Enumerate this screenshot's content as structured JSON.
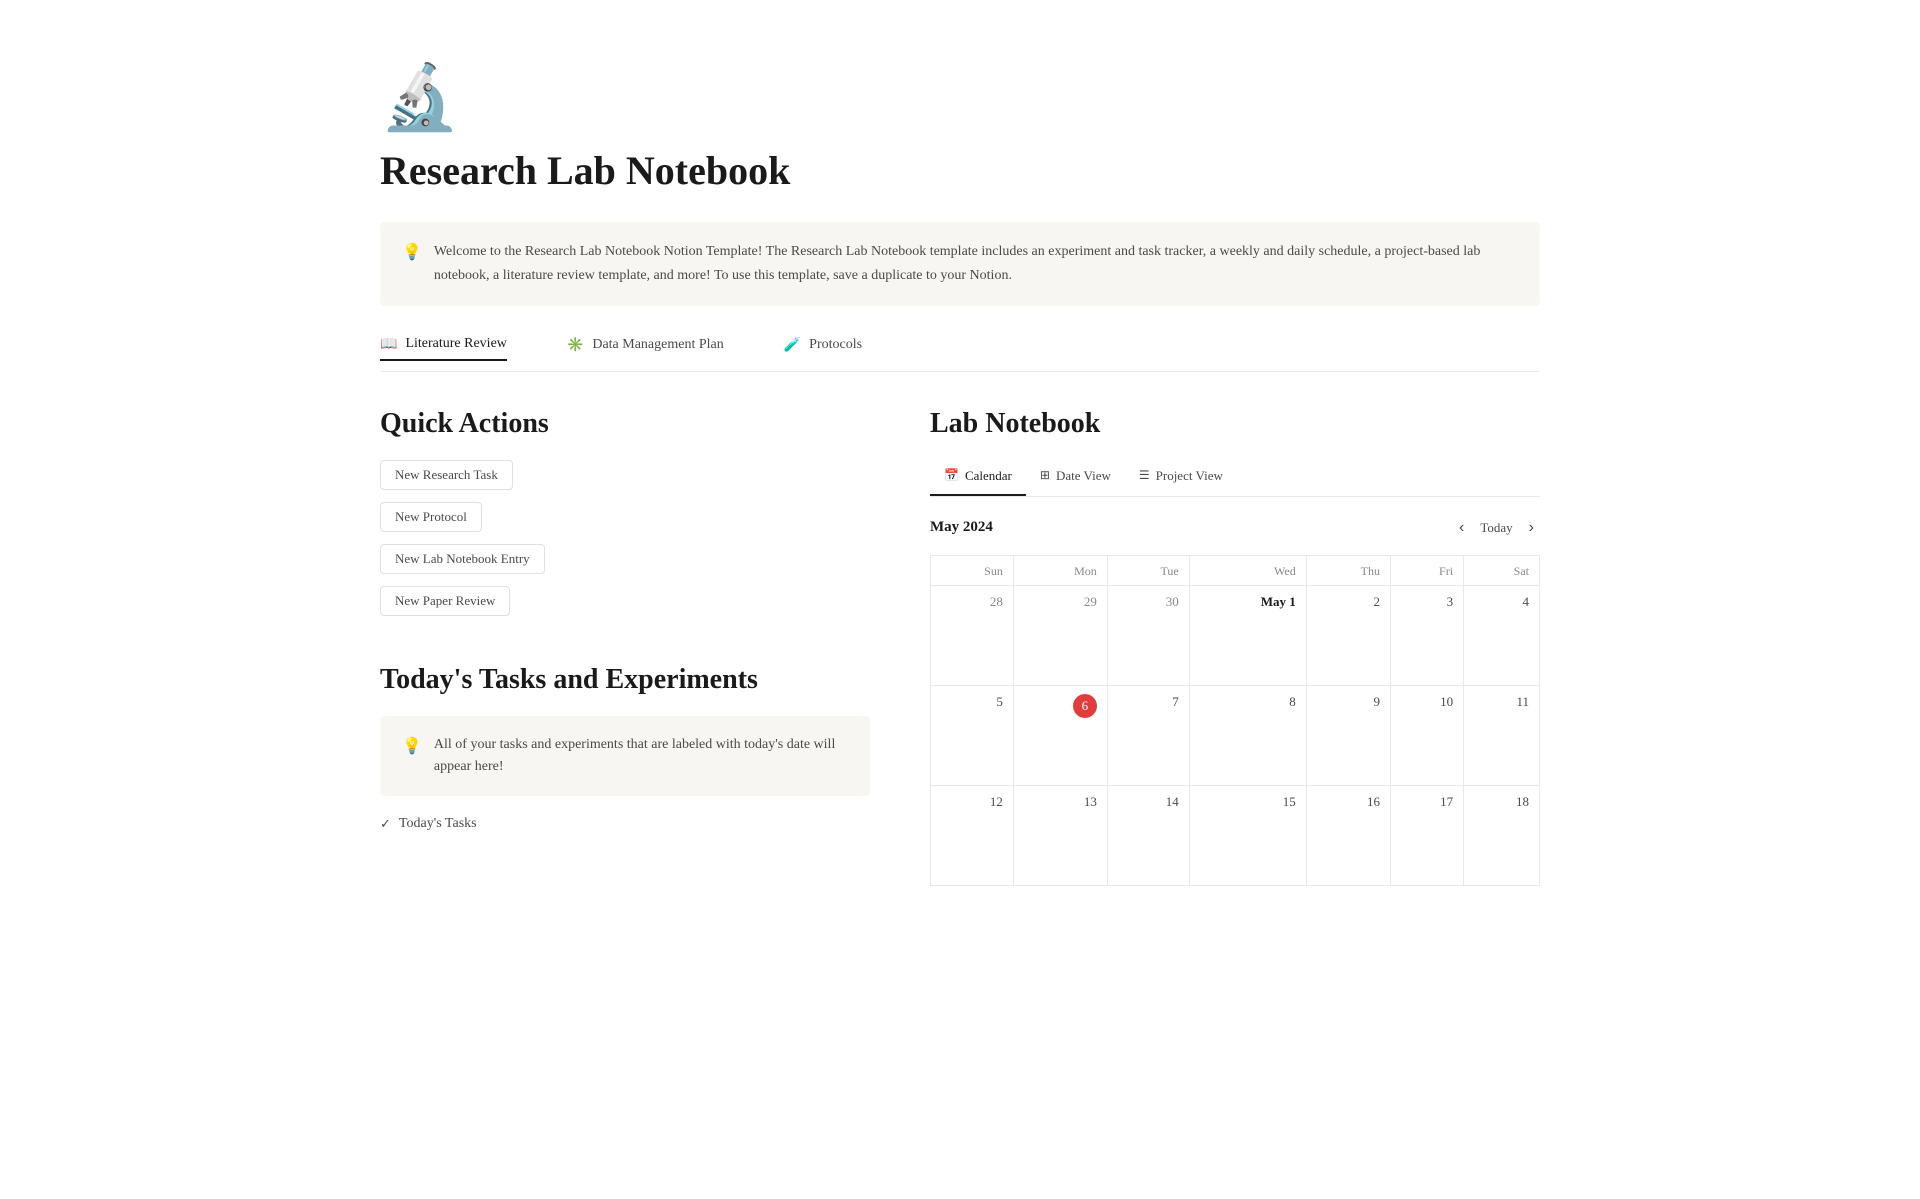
{
  "page": {
    "icon": "🔬",
    "title": "Research Lab Notebook",
    "info_text": "Welcome to the Research Lab Notebook Notion Template!  The Research Lab Notebook template includes an experiment and task tracker, a weekly and daily schedule, a project-based lab notebook, a literature review template, and more! To use this template, save a duplicate to your Notion.",
    "info_icon": "💡"
  },
  "nav": {
    "links": [
      {
        "icon": "📖",
        "label": "Literature Review",
        "active": true
      },
      {
        "icon": "✳️",
        "label": "Data Management Plan",
        "active": false
      },
      {
        "icon": "🧪",
        "label": "Protocols",
        "active": false
      }
    ]
  },
  "quick_actions": {
    "title": "Quick Actions",
    "buttons": [
      {
        "label": "New Research Task"
      },
      {
        "label": "New Protocol"
      },
      {
        "label": "New Lab Notebook Entry"
      },
      {
        "label": "New Paper Review"
      }
    ]
  },
  "todays_tasks": {
    "title": "Today's Tasks and Experiments",
    "info_icon": "💡",
    "info_text": "All of your tasks and experiments that are labeled with today's date will appear here!",
    "link_label": "Today's Tasks"
  },
  "lab_notebook": {
    "title": "Lab Notebook",
    "tabs": [
      {
        "icon": "📅",
        "label": "Calendar",
        "active": true
      },
      {
        "icon": "⊞",
        "label": "Date View",
        "active": false
      },
      {
        "icon": "☰",
        "label": "Project View",
        "active": false
      }
    ],
    "calendar": {
      "month": "May 2024",
      "today_label": "Today",
      "day_headers": [
        "Sun",
        "Mon",
        "Tue",
        "Wed",
        "Thu",
        "Fri",
        "Sat"
      ],
      "weeks": [
        [
          {
            "num": "28",
            "current": false
          },
          {
            "num": "29",
            "current": false
          },
          {
            "num": "30",
            "current": false
          },
          {
            "num": "May 1",
            "current": true,
            "highlight": true
          },
          {
            "num": "2",
            "current": true
          },
          {
            "num": "3",
            "current": true
          },
          {
            "num": "4",
            "current": true
          }
        ],
        [
          {
            "num": "5",
            "current": true
          },
          {
            "num": "6",
            "current": true,
            "today": true
          },
          {
            "num": "7",
            "current": true
          },
          {
            "num": "8",
            "current": true
          },
          {
            "num": "9",
            "current": true
          },
          {
            "num": "10",
            "current": true
          },
          {
            "num": "11",
            "current": true
          }
        ],
        [
          {
            "num": "12",
            "current": true
          },
          {
            "num": "13",
            "current": true
          },
          {
            "num": "14",
            "current": true
          },
          {
            "num": "15",
            "current": true
          },
          {
            "num": "16",
            "current": true
          },
          {
            "num": "17",
            "current": true
          },
          {
            "num": "18",
            "current": true
          }
        ]
      ]
    }
  }
}
